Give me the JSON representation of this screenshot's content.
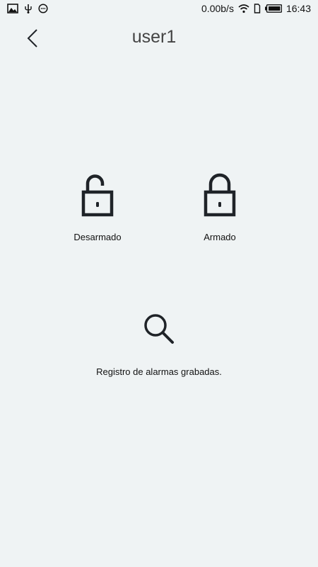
{
  "status_bar": {
    "network_speed": "0.00b/s",
    "time": "16:43",
    "left_icons": [
      "image-icon",
      "usb-icon",
      "chat-icon"
    ],
    "right_icons": [
      "wifi-icon",
      "sim-icon",
      "battery-icon"
    ]
  },
  "header": {
    "title": "user1",
    "back_icon": "chevron-left-icon"
  },
  "actions": {
    "disarm": {
      "label": "Desarmado",
      "icon": "unlocked-padlock-icon"
    },
    "arm": {
      "label": "Armado",
      "icon": "locked-padlock-icon"
    },
    "records": {
      "label": "Registro de alarmas grabadas.",
      "icon": "search-icon"
    }
  },
  "colors": {
    "background": "#eff3f4",
    "icon": "#1f2328",
    "title": "#444444"
  }
}
